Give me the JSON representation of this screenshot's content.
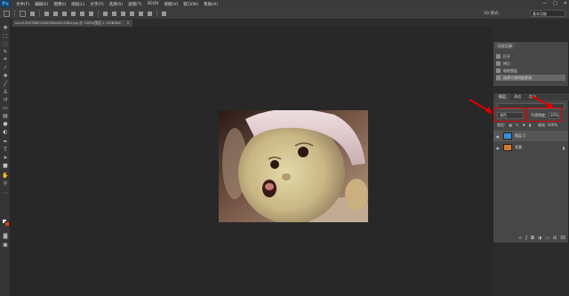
{
  "menubar": {
    "logo": "Ps",
    "items": [
      "文件(F)",
      "编辑(E)",
      "图像(I)",
      "图层(L)",
      "文字(Y)",
      "选择(S)",
      "滤镜(T)",
      "3D(D)",
      "视图(V)",
      "窗口(W)",
      "帮助(H)"
    ],
    "win_min": "—",
    "win_max": "□",
    "win_close": "✕"
  },
  "options": {
    "mode_3d": "3D 模式:",
    "workspace": "基本功能"
  },
  "document": {
    "tab_title": "sccx1550788510b2958a5b1458b.jpg @ 100%(图层 1, RGB/8#)",
    "close": "×"
  },
  "history": {
    "tab": "历史记录",
    "items": [
      "打开",
      "拷贝",
      "粘贴图层",
      "选择不透明度更改"
    ]
  },
  "layers": {
    "tabs": [
      "图层",
      "通道",
      "路径"
    ],
    "blend_mode": "滤色",
    "opacity_label": "不透明度:",
    "opacity_value": "20%",
    "lock_label": "锁定:",
    "fill_label": "填充: 100%",
    "rows": [
      {
        "name": "图层 1",
        "selected": true
      },
      {
        "name": "背景",
        "selected": false
      }
    ],
    "footer_icons": [
      "link-icon",
      "fx-icon",
      "mask-icon",
      "adjustment-icon",
      "group-icon",
      "new-layer-icon",
      "trash-icon"
    ]
  },
  "colors": {
    "foreground": "#e8e8e8",
    "background": "#d8430f",
    "annotation": "#e00000",
    "layer1_thumb": "#3b8fe0",
    "bg_thumb": "#d87a2a"
  }
}
